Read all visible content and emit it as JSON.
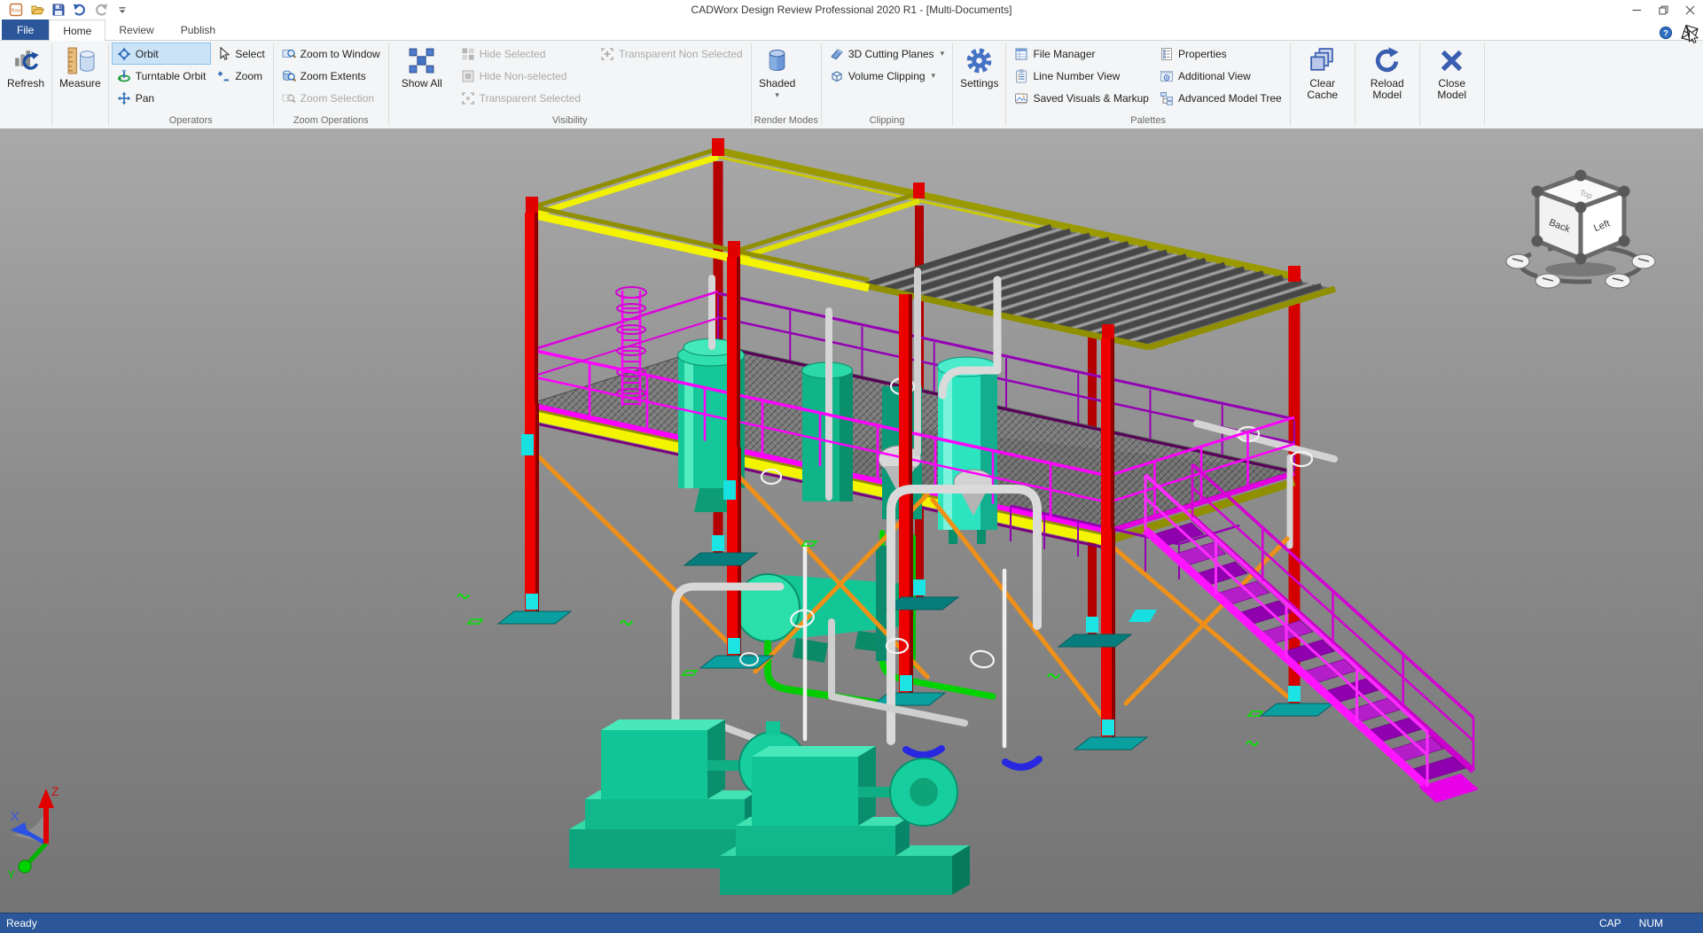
{
  "title_bar": {
    "title": "CADWorx Design Review Professional 2020 R1 - [Multi-Documents]"
  },
  "qat": {
    "buttons": [
      "application-icon",
      "open",
      "save",
      "undo",
      "redo",
      "customize-quick-access"
    ]
  },
  "tabs": [
    {
      "label": "File"
    },
    {
      "label": "Home"
    },
    {
      "label": "Review"
    },
    {
      "label": "Publish"
    }
  ],
  "ribbon": {
    "groups": [
      {
        "label": "",
        "items": [
          {
            "label": "Refresh",
            "icon": "refresh-icon"
          }
        ]
      },
      {
        "label": "",
        "items": [
          {
            "label": "Measure",
            "icon": "measure-icon"
          }
        ]
      },
      {
        "label": "Operators",
        "items": [
          {
            "label": "Orbit",
            "icon": "orbit-icon",
            "selected": true
          },
          {
            "label": "Turntable Orbit",
            "icon": "turntable-orbit-icon"
          },
          {
            "label": "Pan",
            "icon": "pan-icon"
          },
          {
            "label": "Select",
            "icon": "select-cursor-icon"
          },
          {
            "label": "Zoom",
            "icon": "zoom-icon"
          }
        ]
      },
      {
        "label": "Zoom Operations",
        "items": [
          {
            "label": "Zoom to Window",
            "icon": "zoom-window-icon"
          },
          {
            "label": "Zoom Extents",
            "icon": "zoom-extents-icon"
          },
          {
            "label": "Zoom Selection",
            "icon": "zoom-selection-icon",
            "disabled": true
          }
        ]
      },
      {
        "label": "Visibility",
        "items": [
          {
            "label": "Show All",
            "icon": "show-all-icon"
          },
          {
            "label": "Hide Selected",
            "icon": "hide-selected-icon",
            "disabled": true
          },
          {
            "label": "Hide Non-selected",
            "icon": "hide-nonselected-icon",
            "disabled": true
          },
          {
            "label": "Transparent Selected",
            "icon": "transparent-selected-icon",
            "disabled": true
          },
          {
            "label": "Transparent Non Selected",
            "icon": "transparent-nonselected-icon",
            "disabled": true
          }
        ]
      },
      {
        "label": "Render Modes",
        "items": [
          {
            "label": "Shaded",
            "icon": "shaded-cylinder-icon",
            "dropdown": true
          }
        ]
      },
      {
        "label": "Clipping",
        "items": [
          {
            "label": "3D Cutting Planes",
            "icon": "cutting-planes-icon",
            "dropdown": true
          },
          {
            "label": "Volume Clipping",
            "icon": "volume-clipping-icon",
            "dropdown": true
          }
        ]
      },
      {
        "label": "",
        "items": [
          {
            "label": "Settings",
            "icon": "gear-icon"
          }
        ]
      },
      {
        "label": "Palettes",
        "items": [
          {
            "label": "File Manager",
            "icon": "file-manager-icon"
          },
          {
            "label": "Line Number View",
            "icon": "line-number-view-icon"
          },
          {
            "label": "Saved Visuals & Markup",
            "icon": "saved-visuals-icon"
          },
          {
            "label": "Properties",
            "icon": "properties-icon"
          },
          {
            "label": "Additional View",
            "icon": "additional-view-icon"
          },
          {
            "label": "Advanced Model Tree",
            "icon": "model-tree-icon"
          }
        ]
      },
      {
        "label": "",
        "items": [
          {
            "label": "Clear Cache",
            "icon": "clear-cache-icon"
          }
        ]
      },
      {
        "label": "",
        "items": [
          {
            "label": "Reload Model",
            "icon": "reload-model-icon"
          }
        ]
      },
      {
        "label": "",
        "items": [
          {
            "label": "Close Model",
            "icon": "close-model-icon"
          }
        ]
      }
    ]
  },
  "viewport": {
    "view_cube": {
      "top_face": "Top",
      "faces": [
        "Back",
        "Left"
      ]
    },
    "axis_triad": {
      "x": "X",
      "y": "Y",
      "z": "Z"
    }
  },
  "status_bar": {
    "message": "Ready",
    "cap": "CAP",
    "num": "NUM"
  },
  "colors": {
    "accent_blue": "#2b579a",
    "steel_red": "#ee0000",
    "beam_yellow": "#f4f400",
    "beam_olive": "#8f8f00",
    "handrail_magenta": "#ff00ff",
    "equipment_teal": "#17cf9a",
    "brace_orange": "#ef9018",
    "viewport_gray_top": "#a9a9a9",
    "viewport_gray_bottom": "#747474"
  }
}
